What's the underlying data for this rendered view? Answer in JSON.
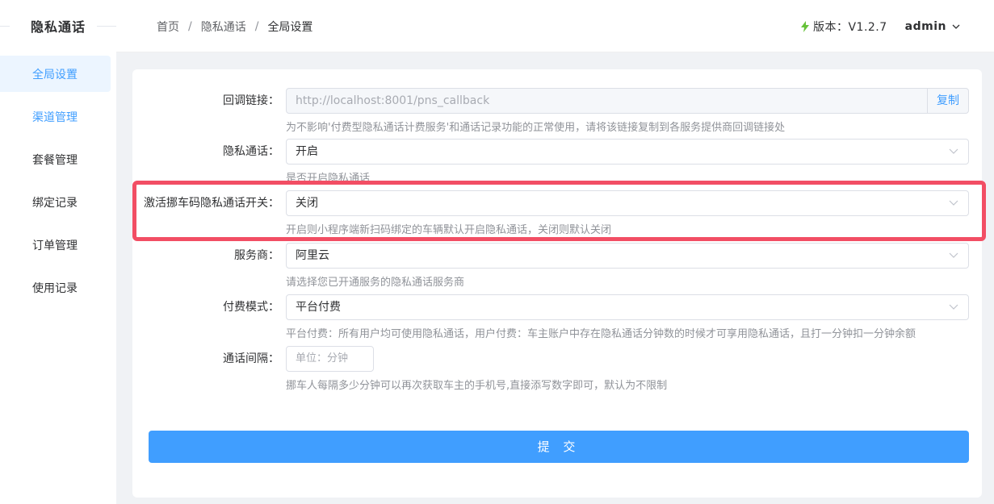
{
  "sidebar": {
    "brand": "隐私通话",
    "items": [
      {
        "label": "全局设置"
      },
      {
        "label": "渠道管理"
      },
      {
        "label": "套餐管理"
      },
      {
        "label": "绑定记录"
      },
      {
        "label": "订单管理"
      },
      {
        "label": "使用记录"
      }
    ]
  },
  "header": {
    "breadcrumb": [
      "首页",
      "隐私通话",
      "全局设置"
    ],
    "separator": "/",
    "version": "版本：V1.2.7",
    "user": "admin"
  },
  "form": {
    "callback": {
      "label": "回调链接：",
      "value": "http://localhost:8001/pns_callback",
      "copy": "复制",
      "help": "为不影响'付费型隐私通话计费服务'和通话记录功能的正常使用，请将该链接复制到各服务提供商回调链接处"
    },
    "privacy": {
      "label": "隐私通话：",
      "value": "开启",
      "help": "是否开启隐私通话"
    },
    "activate": {
      "label": "激活挪车码隐私通话开关：",
      "value": "关闭",
      "help": "开启则小程序端新扫码绑定的车辆默认开启隐私通话，关闭则默认关闭"
    },
    "provider": {
      "label": "服务商：",
      "value": "阿里云",
      "help": "请选择您已开通服务的隐私通话服务商"
    },
    "payment": {
      "label": "付费模式：",
      "value": "平台付费",
      "help": "平台付费：所有用户均可使用隐私通话，用户付费：车主账户中存在隐私通话分钟数的时候才可享用隐私通话，且打一分钟扣一分钟余额"
    },
    "interval": {
      "label": "通话间隔：",
      "placeholder": "单位：分钟",
      "help": "挪车人每隔多少分钟可以再次获取车主的手机号,直接添写数字即可，默认为不限制"
    },
    "submit": "提 交"
  },
  "colors": {
    "primary": "#409eff",
    "highlight": "#f24e64",
    "bolt": "#67c23a"
  }
}
